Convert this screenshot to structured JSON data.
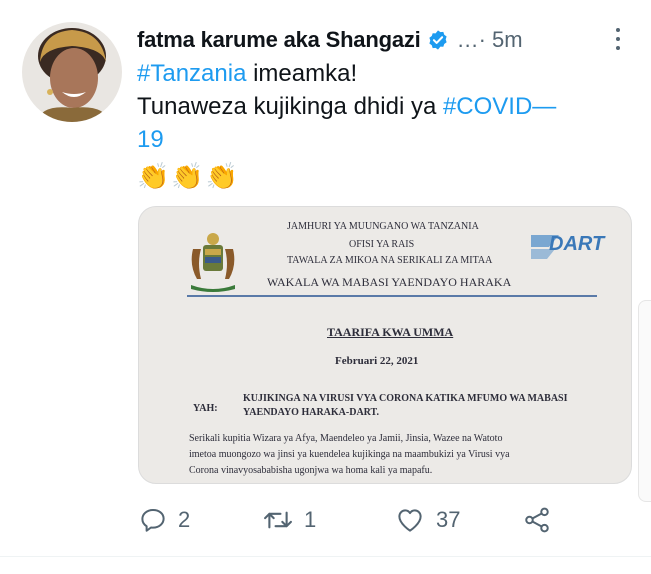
{
  "tweet": {
    "author": {
      "display_name": "fatma karume aka Shangazi",
      "verified": true
    },
    "meta": "…· 5m",
    "text": {
      "hashtag1": "#Tanzania",
      "line1_rest": " imeamka!",
      "line2_start": "Tunaweza kujikinga dhidi ya ",
      "hashtag2": "#COVID—",
      "line3": "19"
    },
    "emojis": [
      "👏",
      "👏",
      "👏"
    ],
    "media_document": {
      "header1": "JAMHURI YA MUUNGANO WA TANZANIA",
      "header2": "OFISI YA RAIS",
      "header3": "TAWALA ZA MIKOA NA SERIKALI ZA MITAA",
      "header4": "WAKALA WA MABASI YAENDAYO HARAKA",
      "logo_text": "DART",
      "title": "TAARIFA KWA UMMA",
      "date": "Februari 22, 2021",
      "subject_label": "YAH:",
      "subject_line1": "KUJIKINGA NA VIRUSI VYA CORONA KATIKA MFUMO WA MABASI",
      "subject_line2": "YAENDAYO HARAKA-DART.",
      "body_line1": "Serikali kupitia Wizara ya Afya, Maendeleo ya Jamii, Jinsia, Wazee na Watoto",
      "body_line2": "imetoa muongozo wa jinsi ya kuendelea kujikinga na maambukizi ya Virusi vya",
      "body_line3": "Corona vinavyosababisha ugonjwa wa homa kali ya mapafu."
    },
    "actions": {
      "reply_count": "2",
      "retweet_count": "1",
      "like_count": "37"
    },
    "colors": {
      "link": "#1d9bf0",
      "secondary": "#536471",
      "verified": "#1d9bf0"
    }
  }
}
